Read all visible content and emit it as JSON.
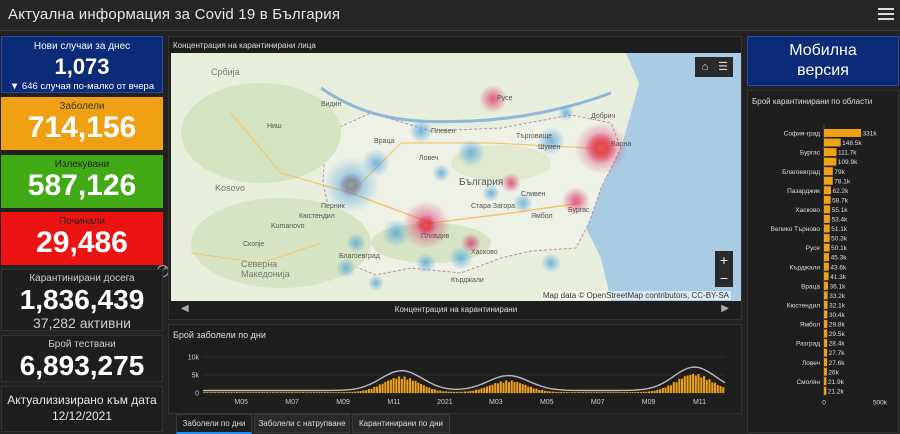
{
  "header": {
    "title": "Актуална информация за Covid 19 в България"
  },
  "cards": {
    "new": {
      "label": "Нови случаи за днес",
      "value": "1,073",
      "sub": "▼ 646 случая по-малко от вчера"
    },
    "sick": {
      "label": "Заболели",
      "value": "714,156"
    },
    "cured": {
      "label": "Излекувани",
      "value": "587,126"
    },
    "dead": {
      "label": "Починали",
      "value": "29,486"
    },
    "quarantined": {
      "label": "Карантинирани досега",
      "value": "1,836,439",
      "sub": "37,282 активни"
    },
    "tested": {
      "label": "Брой тествани",
      "value": "6,893,275"
    },
    "updated": {
      "line1": "Актуализизирано към дата",
      "line2": "12/12/2021"
    }
  },
  "map": {
    "title": "Концентрация на карантинирани лица",
    "attribution": "Map data © OpenStreetMap contributors, CC-BY-SA",
    "nav_label": "Концентрация на карантинирани",
    "home_icon": "home-icon",
    "list_icon": "list-icon",
    "zoom_in": "+",
    "zoom_out": "−",
    "country_labels": [
      "Србија",
      "Kosovo",
      "Северна Македонија",
      "България"
    ],
    "city_labels": [
      "Ниш",
      "Видин",
      "Враца",
      "Плевен",
      "Ловеч",
      "Русе",
      "Варна",
      "Шумен",
      "Бургас",
      "Пловдив",
      "Хасково",
      "Скопје",
      "Kumanovo",
      "Търговище",
      "Добрич",
      "Сливен",
      "Ямбол",
      "Стара Загора",
      "Кърджали",
      "Перник",
      "Кюстендил",
      "Благоевград"
    ]
  },
  "mobile": {
    "line1": "Мобилна",
    "line2": "версия"
  },
  "tabs": [
    "Заболели по дни",
    "Заболели с натрупване",
    "Карантинирани по дни"
  ],
  "chart_data": [
    {
      "type": "bar",
      "title": "Брой карантинирани по области",
      "orientation": "horizontal",
      "categories": [
        "София-град",
        "",
        "Бургас",
        "",
        "Благоевград",
        "",
        "Пазарджик",
        "",
        "Хасково",
        "",
        "Велико Търново",
        "",
        "Русе",
        "",
        "Кърджали",
        "",
        "Враца",
        "",
        "Кюстендил",
        "",
        "Ямбол",
        "",
        "Разград",
        "",
        "Ловеч",
        "",
        "Смолян",
        ""
      ],
      "values": [
        331000,
        148500,
        111700,
        109900,
        79000,
        78100,
        62200,
        58700,
        55100,
        53400,
        51100,
        50300,
        50100,
        45300,
        43600,
        41300,
        36100,
        33200,
        32100,
        30400,
        29800,
        29500,
        28400,
        27700,
        27600,
        26000,
        21900,
        21200
      ],
      "value_labels": [
        "331k",
        "148.5k",
        "111.7k",
        "109.9k",
        "79k",
        "78.1k",
        "62.2k",
        "58.7k",
        "55.1k",
        "53.4k",
        "51.1k",
        "50.3k",
        "50.1k",
        "45.3k",
        "43.6k",
        "41.3k",
        "36.1k",
        "33.2k",
        "32.1k",
        "30.4k",
        "29.8k",
        "29.5k",
        "28.4k",
        "27.7k",
        "27.6k",
        "26k",
        "21.9k",
        "21.2k"
      ],
      "xlim": [
        0,
        500000
      ],
      "xticks": [
        "0",
        "500k"
      ],
      "color": "#f0a113"
    },
    {
      "type": "bar",
      "title": "Брой заболели по дни",
      "x_ticks": [
        "M05",
        "M07",
        "M09",
        "M11",
        "2021",
        "M03",
        "M05",
        "M07",
        "M09",
        "M11"
      ],
      "y_ticks": [
        "0",
        "5k",
        "10k"
      ],
      "ylim": [
        0,
        10000
      ],
      "waves": [
        {
          "month": 11.3,
          "peak": 4400
        },
        {
          "month": 15.5,
          "peak": 3300
        },
        {
          "month": 22.8,
          "peak": 5200
        }
      ],
      "color": "#f0a113",
      "avg_color": "#bbbbbb"
    }
  ]
}
